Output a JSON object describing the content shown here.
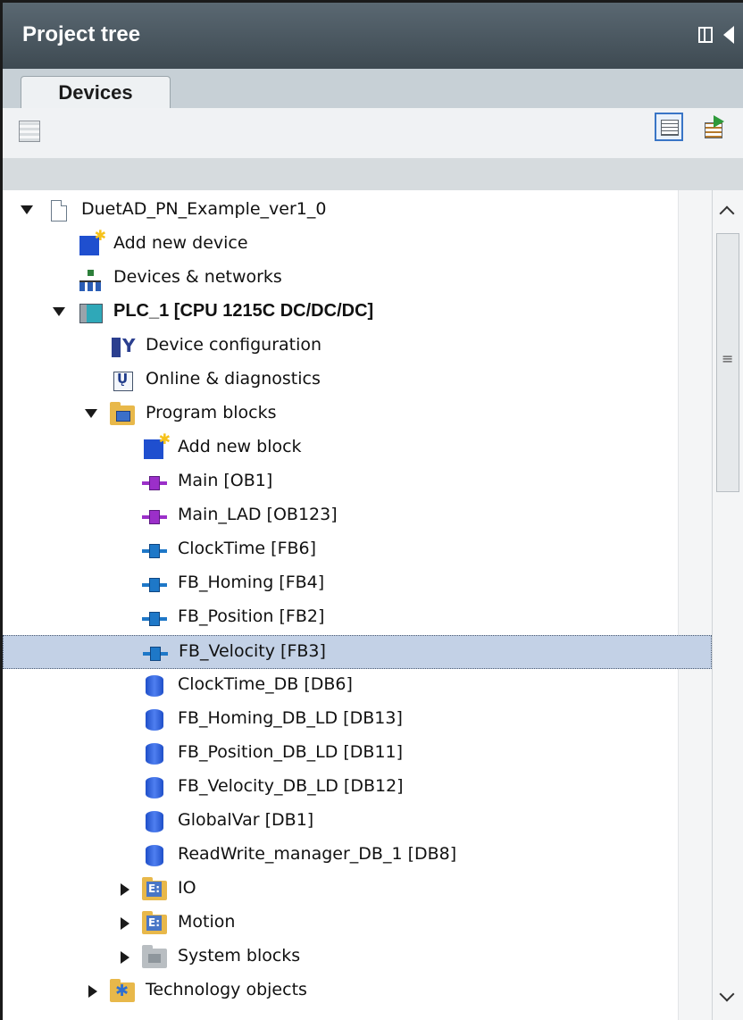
{
  "panel": {
    "title": "Project tree"
  },
  "tabs": [
    {
      "label": "Devices"
    }
  ],
  "tree": {
    "items": [
      {
        "label": "DuetAD_PN_Example_ver1_0",
        "icon": "document-icon"
      },
      {
        "label": "Add new device",
        "icon": "add-device-icon"
      },
      {
        "label": "Devices & networks",
        "icon": "network-icon"
      },
      {
        "label": "PLC_1 [CPU 1215C DC/DC/DC]",
        "icon": "plc-icon"
      },
      {
        "label": "Device configuration",
        "icon": "device-config-icon"
      },
      {
        "label": "Online & diagnostics",
        "icon": "diagnostics-icon"
      },
      {
        "label": "Program blocks",
        "icon": "program-blocks-folder-icon"
      },
      {
        "label": "Add new block",
        "icon": "add-block-icon"
      },
      {
        "label": "Main [OB1]",
        "icon": "ob-block-icon"
      },
      {
        "label": "Main_LAD [OB123]",
        "icon": "ob-block-icon"
      },
      {
        "label": "ClockTime [FB6]",
        "icon": "fb-block-icon"
      },
      {
        "label": "FB_Homing [FB4]",
        "icon": "fb-block-icon"
      },
      {
        "label": "FB_Position [FB2]",
        "icon": "fb-block-icon"
      },
      {
        "label": "FB_Velocity [FB3]",
        "icon": "fb-block-icon"
      },
      {
        "label": "ClockTime_DB [DB6]",
        "icon": "db-icon"
      },
      {
        "label": "FB_Homing_DB_LD [DB13]",
        "icon": "db-icon"
      },
      {
        "label": "FB_Position_DB_LD [DB11]",
        "icon": "db-icon"
      },
      {
        "label": "FB_Velocity_DB_LD [DB12]",
        "icon": "db-icon"
      },
      {
        "label": "GlobalVar [DB1]",
        "icon": "db-icon"
      },
      {
        "label": "ReadWrite_manager_DB_1 [DB8]",
        "icon": "db-icon"
      },
      {
        "label": "IO",
        "icon": "io-folder-icon"
      },
      {
        "label": "Motion",
        "icon": "io-folder-icon"
      },
      {
        "label": "System blocks",
        "icon": "system-folder-icon"
      },
      {
        "label": "Technology objects",
        "icon": "technology-folder-icon"
      }
    ],
    "selected_label": "FB_Velocity [FB3]"
  },
  "colors": {
    "titlebar": "#4a5660",
    "selection": "#c3d1e6",
    "ob_block": "#9b2fc9",
    "fb_block": "#1e78c8",
    "db": "#2f5fd8"
  }
}
